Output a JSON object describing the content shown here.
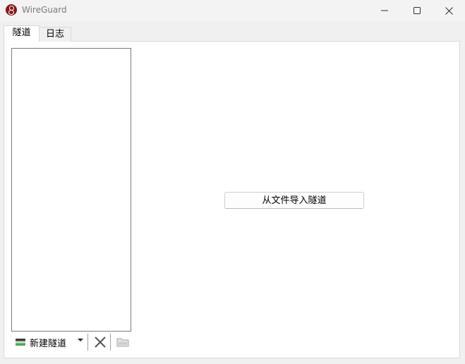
{
  "window": {
    "title": "WireGuard",
    "controls": {
      "minimize": "minimize-icon",
      "maximize": "maximize-icon",
      "close": "close-icon"
    },
    "accent": "#88171a"
  },
  "tabs": [
    {
      "label": "隧道",
      "selected": true
    },
    {
      "label": "日志",
      "selected": false
    }
  ],
  "tunnels": {
    "items": [],
    "toolbar": {
      "add_label": "新建隧道",
      "add_icon": "add-tunnel-icon",
      "dropdown_icon": "chevron-down-icon",
      "delete_icon": "delete-icon",
      "export_icon": "export-folder-icon"
    }
  },
  "main": {
    "import_button_label": "从文件导入隧道"
  }
}
